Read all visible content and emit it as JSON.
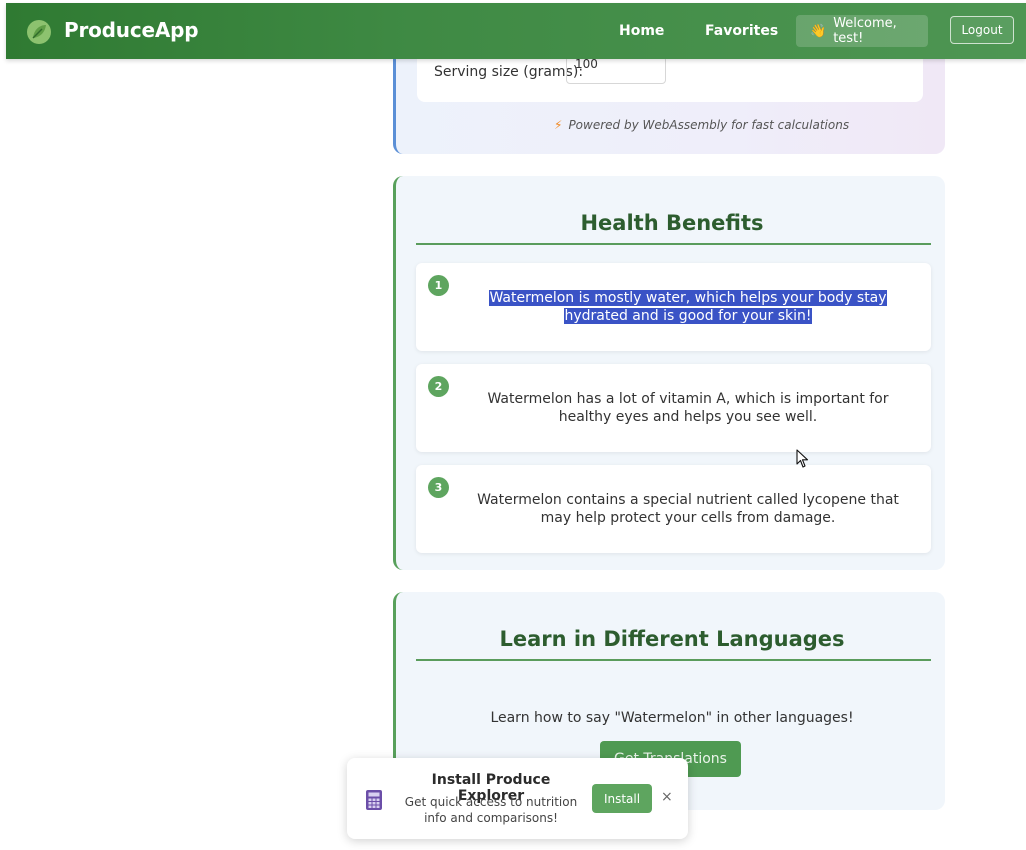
{
  "header": {
    "brand": "ProduceApp",
    "nav": {
      "home": "Home",
      "favorites": "Favorites"
    },
    "welcome": "Welcome, test!",
    "welcome_icon": "waving-hand-icon",
    "logout": "Logout",
    "brand_color": "#3f8a44"
  },
  "nutrition": {
    "serving_label": "Serving size (grams):",
    "serving_value": "100",
    "powered_by": "Powered by WebAssembly for fast calculations"
  },
  "benefits": {
    "title": "Health Benefits",
    "items": [
      {
        "num": "1",
        "text": "Watermelon is mostly water, which helps your body stay hydrated and is good for your skin!",
        "selected": true
      },
      {
        "num": "2",
        "text": "Watermelon has a lot of vitamin A, which is important for healthy eyes and helps you see well."
      },
      {
        "num": "3",
        "text": "Watermelon contains a special nutrient called lycopene that may help protect your cells from damage."
      }
    ]
  },
  "languages": {
    "title": "Learn in Different Languages",
    "subtitle": "Learn how to say \"Watermelon\" in other languages!",
    "button": "Get Translations"
  },
  "install_prompt": {
    "title": "Install Produce Explorer",
    "description": "Get quick access to nutrition info and comparisons!",
    "install_button": "Install",
    "close": "×",
    "icon": "calculator-icon"
  }
}
